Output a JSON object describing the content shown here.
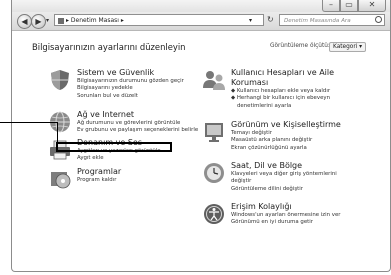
{
  "window": {
    "address": "Denetim Masası",
    "search_placeholder": "Denetim Masasında Ara",
    "buttons": [
      "–",
      "▭",
      "✕"
    ]
  },
  "header": {
    "title": "Bilgisayarınızın ayarlarını düzenleyin",
    "view_by_label": "Görüntüleme ölçütü:",
    "view_by_value": "Kategori ▾"
  },
  "categories": [
    {
      "title": "Sistem ve Güvenlik",
      "links": [
        "Bilgisayarınızın durumunu gözden geçir",
        "Bilgisayarını yedekle",
        "Sorunları bul ve düzelt"
      ]
    },
    {
      "title": "Ağ ve Internet",
      "links": [
        "Ağ durumunu ve görevlerini görüntüle",
        "Ev grubunu ve paylaşım seçeneklerini belirle"
      ]
    },
    {
      "title": "Donanım ve Ses",
      "links": [
        "Aygıtları ve yazıcıları görüntüle",
        "Aygıt ekle"
      ]
    },
    {
      "title": "Programlar",
      "links": [
        "Program kaldır"
      ]
    },
    {
      "title": "Kullanıcı Hesapları ve Aile",
      "title2": "Koruması",
      "links": [
        "Kullanıcı hesapları ekle veya kaldır",
        "Herhangi bir kullanıcı için ebeveyn",
        "denetimlerini ayarla"
      ]
    },
    {
      "title": "Görünüm ve Kişiselleştirme",
      "links": [
        "Temayı değiştir",
        "Masaüstü arka planını değiştir",
        "Ekran çözünürlüğünü ayarla"
      ]
    },
    {
      "title": "Saat, Dil ve Bölge",
      "links": [
        "Klavyeleri veya diğer giriş yöntemlerini",
        "değiştir",
        "Görüntüleme dilini değiştir"
      ]
    },
    {
      "title": "Erişim Kolaylığı",
      "links": [
        "Windows'un ayarları önermesine izin ver",
        "Görünümü en iyi duruma getir"
      ]
    }
  ]
}
